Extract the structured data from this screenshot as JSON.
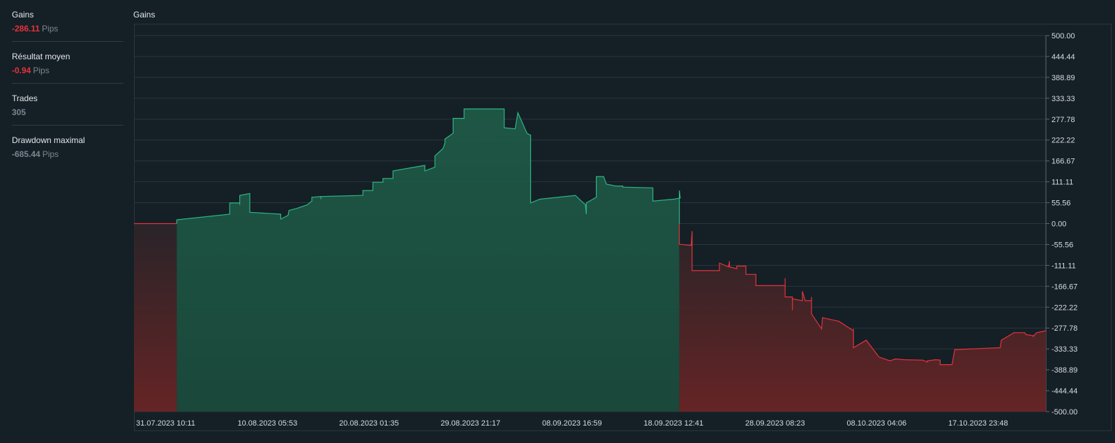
{
  "sidebar": {
    "stats": [
      {
        "label": "Gains",
        "value": "-286.11",
        "unit": "Pips",
        "tone": "neg"
      },
      {
        "label": "Résultat moyen",
        "value": "-0.94",
        "unit": "Pips",
        "tone": "neg"
      },
      {
        "label": "Trades",
        "value": "305",
        "unit": "",
        "tone": "muted"
      },
      {
        "label": "Drawdown maximal",
        "value": "-685.44",
        "unit": "Pips",
        "tone": "muted"
      }
    ]
  },
  "chart": {
    "title": "Gains"
  },
  "colors": {
    "background": "#151f26",
    "positive": "#2bb683",
    "negative": "#e5333c",
    "grid": "#2a363e"
  },
  "chart_data": {
    "type": "area",
    "title": "Gains",
    "xlabel": "",
    "ylabel": "",
    "ylim": [
      -500,
      500
    ],
    "y_ticks": [
      "500.00",
      "444.44",
      "388.89",
      "333.33",
      "277.78",
      "222.22",
      "166.67",
      "111.11",
      "55.56",
      "0.00",
      "-55.56",
      "-111.11",
      "-166.67",
      "-222.22",
      "-277.78",
      "-333.33",
      "-388.89",
      "-444.44",
      "-500.00"
    ],
    "x_ticks": [
      "31.07.2023 10:11",
      "10.08.2023 05:53",
      "20.08.2023 01:35",
      "29.08.2023 21:17",
      "08.09.2023 16:59",
      "18.09.2023 12:41",
      "28.09.2023 08:23",
      "08.10.2023 04:06",
      "17.10.2023 23:48"
    ],
    "grid": true,
    "points": [
      [
        0,
        0
      ],
      [
        4.7,
        0
      ],
      [
        4.7,
        10
      ],
      [
        10.5,
        25
      ],
      [
        10.5,
        55
      ],
      [
        11.6,
        55
      ],
      [
        11.6,
        50
      ],
      [
        11.6,
        75
      ],
      [
        12.7,
        80
      ],
      [
        12.7,
        30
      ],
      [
        16.1,
        25
      ],
      [
        16.1,
        12
      ],
      [
        16.9,
        22
      ],
      [
        17,
        35
      ],
      [
        17.8,
        40
      ],
      [
        19,
        50
      ],
      [
        19.5,
        60
      ],
      [
        19.5,
        70
      ],
      [
        20.5,
        72
      ],
      [
        20.5,
        65
      ],
      [
        20.5,
        72
      ],
      [
        25.1,
        75
      ],
      [
        25.1,
        88
      ],
      [
        26.2,
        88
      ],
      [
        26.2,
        110
      ],
      [
        27.3,
        110
      ],
      [
        27.3,
        120
      ],
      [
        28.4,
        120
      ],
      [
        28.4,
        140
      ],
      [
        31.9,
        155
      ],
      [
        31.9,
        140
      ],
      [
        33,
        150
      ],
      [
        33,
        180
      ],
      [
        33.9,
        200
      ],
      [
        34.1,
        215
      ],
      [
        34.1,
        225
      ],
      [
        35,
        240
      ],
      [
        35,
        280
      ],
      [
        36.2,
        280
      ],
      [
        36.2,
        305
      ],
      [
        40.6,
        305
      ],
      [
        40.6,
        255
      ],
      [
        41.8,
        252
      ],
      [
        42.1,
        295
      ],
      [
        43.1,
        240
      ],
      [
        43.5,
        235
      ],
      [
        43.5,
        55
      ],
      [
        44.5,
        65
      ],
      [
        48.4,
        75
      ],
      [
        49.5,
        50
      ],
      [
        49.6,
        25
      ],
      [
        49.6,
        55
      ],
      [
        50.7,
        70
      ],
      [
        50.7,
        125
      ],
      [
        51.5,
        125
      ],
      [
        51.8,
        105
      ],
      [
        52.8,
        100
      ],
      [
        53.6,
        100
      ],
      [
        53.6,
        97
      ],
      [
        56.9,
        95
      ],
      [
        56.9,
        60
      ],
      [
        59.2,
        65
      ],
      [
        59.9,
        68
      ],
      [
        59.8,
        88
      ],
      [
        59.8,
        0
      ],
      [
        59.8,
        -55
      ],
      [
        61.1,
        -58
      ],
      [
        61.2,
        -20
      ],
      [
        61.2,
        -125
      ],
      [
        64.2,
        -125
      ],
      [
        64.2,
        -105
      ],
      [
        65.2,
        -115
      ],
      [
        65.3,
        -100
      ],
      [
        65.3,
        -115
      ],
      [
        66.1,
        -120
      ],
      [
        66.1,
        -113
      ],
      [
        67.1,
        -113
      ],
      [
        67.1,
        -135
      ],
      [
        68.2,
        -135
      ],
      [
        68.2,
        -165
      ],
      [
        71.4,
        -165
      ],
      [
        71.4,
        -145
      ],
      [
        71.4,
        -195
      ],
      [
        72.2,
        -195
      ],
      [
        72.2,
        -230
      ],
      [
        72.2,
        -200
      ],
      [
        73.3,
        -205
      ],
      [
        73.3,
        -180
      ],
      [
        73.6,
        -205
      ],
      [
        74.3,
        -205
      ],
      [
        74.3,
        -195
      ],
      [
        74.3,
        -240
      ],
      [
        75.4,
        -280
      ],
      [
        75.5,
        -250
      ],
      [
        77.3,
        -260
      ],
      [
        78.9,
        -285
      ],
      [
        78.9,
        -280
      ],
      [
        78.9,
        -330
      ],
      [
        80.3,
        -310
      ],
      [
        81.7,
        -355
      ],
      [
        82.9,
        -365
      ],
      [
        83.5,
        -360
      ],
      [
        84.5,
        -362
      ],
      [
        86.5,
        -363
      ],
      [
        87,
        -368
      ],
      [
        87,
        -365
      ],
      [
        87.9,
        -362
      ],
      [
        88.4,
        -363
      ],
      [
        88.4,
        -375
      ],
      [
        89.7,
        -375
      ],
      [
        90,
        -335
      ],
      [
        95,
        -330
      ],
      [
        95.1,
        -310
      ],
      [
        96.5,
        -290
      ],
      [
        97.7,
        -290
      ],
      [
        97.8,
        -295
      ],
      [
        98.6,
        -298
      ],
      [
        98.6,
        -300
      ],
      [
        99,
        -290
      ],
      [
        100,
        -285
      ]
    ]
  }
}
